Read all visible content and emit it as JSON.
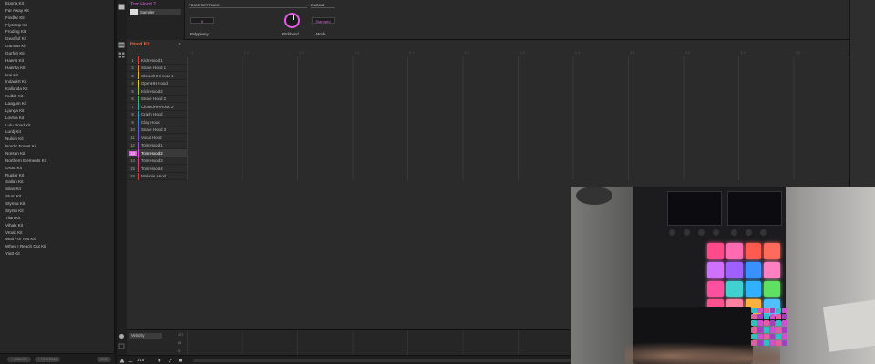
{
  "browser": {
    "kits": [
      "Epona Kit",
      "Far Away Kit",
      "Findlar Kit",
      "Flyssmp Kit",
      "Froding Kit",
      "Gearfluf Kit",
      "Gumlan Kit",
      "Gurfuri Kit",
      "Haeris Kit",
      "Haerita Kit",
      "Isai Kit",
      "Indaakrt Kit",
      "Kallunda Kit",
      "Kulbiz Kit",
      "Laagum Kit",
      "Ljunga Kit",
      "Lovfifa Kit",
      "Lulu Road Kit",
      "Lurdj Kit",
      "Nuloin Kit",
      "Nordic Forest Kit",
      "Norsan Kit",
      "Northern Elements Kit",
      "Orust Kit",
      "Ruplar Kit",
      "Sallan Kit",
      "Silan Kit",
      "Stum Kit",
      "Styrma Kit",
      "Styrso Kit",
      "Tilan Kit",
      "Vihalk Kit",
      "Vroak Kit",
      "Wait For You Kit",
      "When I Reach Out Kit",
      "Yiatt Kit"
    ],
    "footer_left": "+ ANALOG",
    "footer_mid": "+ FILTERING",
    "footer_right": "EDIT"
  },
  "plugin": {
    "sound_name": "Tom Hood 2",
    "plugin_name": "Sampler",
    "voice_settings_label": "VOICE SETTINGS",
    "engine_label": "ENGINE",
    "polyphony_value": "8",
    "polyphony_label": "Polyphony",
    "pitchbend_label": "Pitchbend",
    "mode_value": "Standard",
    "mode_label": "Mode"
  },
  "editor": {
    "group_name": "Hood Kit",
    "ruler_marks": [
      "1.1",
      "1.2",
      "1.3",
      "1.4",
      "2.1",
      "2.2",
      "2.3",
      "2.4",
      "3.1",
      "3.2",
      "3.3",
      "3.4"
    ],
    "sounds": [
      {
        "num": "1",
        "name": "Kick Hood 1",
        "color": "#e04040"
      },
      {
        "num": "2",
        "name": "Snare Hood 1",
        "color": "#e08a30"
      },
      {
        "num": "3",
        "name": "ClosedHH Hood 1",
        "color": "#e0b030"
      },
      {
        "num": "4",
        "name": "OpenHH Hood",
        "color": "#e0d030"
      },
      {
        "num": "5",
        "name": "Kick Hood 2",
        "color": "#90c040"
      },
      {
        "num": "6",
        "name": "Snare Hood 2",
        "color": "#40b050"
      },
      {
        "num": "7",
        "name": "ClosedHH Hood 2",
        "color": "#30b0a0"
      },
      {
        "num": "8",
        "name": "Crash Hood",
        "color": "#30a0c0"
      },
      {
        "num": "9",
        "name": "Clap Hood",
        "color": "#3080d0"
      },
      {
        "num": "10",
        "name": "Snare Hood 3",
        "color": "#5060d0"
      },
      {
        "num": "11",
        "name": "Vocal Hood",
        "color": "#7050d0"
      },
      {
        "num": "12",
        "name": "Tom Hood 1",
        "color": "#a050d0"
      },
      {
        "num": "13",
        "name": "Tom Hood 2",
        "color": "#d050d0"
      },
      {
        "num": "14",
        "name": "Tom Hood 3",
        "color": "#d04090"
      },
      {
        "num": "15",
        "name": "Tom Hood 4",
        "color": "#d04060"
      },
      {
        "num": "16",
        "name": "Malonie Hood",
        "color": "#d04040"
      }
    ],
    "selected_index": 12
  },
  "velocity": {
    "label": "Velocity",
    "scale_max": "127",
    "scale_mid": "63",
    "scale_min": "0"
  },
  "bottom_bar": {
    "zoom": "1/16"
  },
  "colors": {
    "accent": "#d864d8",
    "group": "#e06840"
  },
  "webcam": {
    "pad_colors": [
      "#ff4a8a",
      "#ff6ab0",
      "#ff5a50",
      "#ff6a5a",
      "#d070ff",
      "#a060ff",
      "#3a90ff",
      "#ff80c0",
      "#ff50a0",
      "#40d0d0",
      "#30b0ff",
      "#60e060",
      "#ff5090",
      "#ff80a0",
      "#ffb040",
      "#50c0ff"
    ]
  }
}
